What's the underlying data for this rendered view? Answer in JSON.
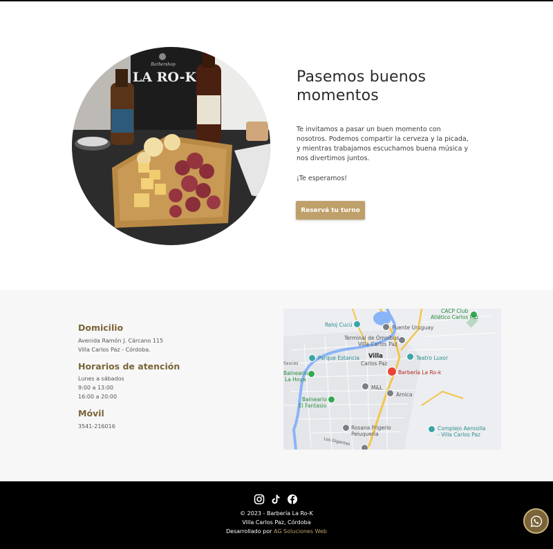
{
  "hero": {
    "title_line1": "Pasemos buenos",
    "title_line2": "momentos",
    "paragraph": "Te invitamos a pasar un buen momento con nosotros. Podemos compartir la cerveza y la picada, y mientras trabajamos escuchamos buena música y nos divertimos juntos.",
    "tagline": "¡Te esperamos!",
    "button_label": "Reservá tu turno",
    "photo_sign": "LA RO-K",
    "photo_sign_top": "Barbershop"
  },
  "info": {
    "address_title": "Domicilio",
    "address_line1": "Avenida Ramón J. Cárcano 115",
    "address_line2": "Villa Carlos Paz - Córdoba.",
    "hours_title": "Horarios de atención",
    "hours_days": "Lunes a sábados",
    "hours_morning": "9:00 a 13:00",
    "hours_evening": "16:00 a 20:00",
    "mobile_title": "Móvil",
    "mobile_number": "3541-216016"
  },
  "map": {
    "labels": {
      "cacp_club": "CACP Club",
      "atletico": "Atlético Carlos Paz",
      "reloj_cucu": "Reloj Cucú",
      "puente": "Puente Uruguay",
      "terminal1": "Terminal de Ómnibus",
      "terminal2": "Villa Carlos Paz",
      "parque": "Parque Estancia",
      "villa": "Villa",
      "carlos_paz": "Carlos Paz",
      "teatro": "Teatro Luxor",
      "sauces": "Sauces",
      "balneario_hoya1": "Balneario",
      "balneario_hoya2": "La Hoya",
      "barberia": "Barbería La Ro-k",
      "mandl": "M&L",
      "arnica": "Arnica",
      "fantasio1": "Balneario",
      "fantasio2": "El Fantasio",
      "rosana1": "Rosana Frigerio",
      "rosana2": "Peluquería",
      "complejo1": "Complejo Aerosilla",
      "complejo2": "- Villa Carlos Paz",
      "gigantes": "Los Gigantes"
    }
  },
  "footer": {
    "copyright": "© 2023 - Barbería La Ro-K",
    "location": "Villa Carlos Paz, Córdoba",
    "developed_prefix": "Desarrollado por",
    "developer": "AG Soluciones Web"
  },
  "colors": {
    "accent": "#bfa06a",
    "heading_brown": "#7a6438",
    "footer_bg": "#000000",
    "info_bg": "#f7f7f7"
  }
}
